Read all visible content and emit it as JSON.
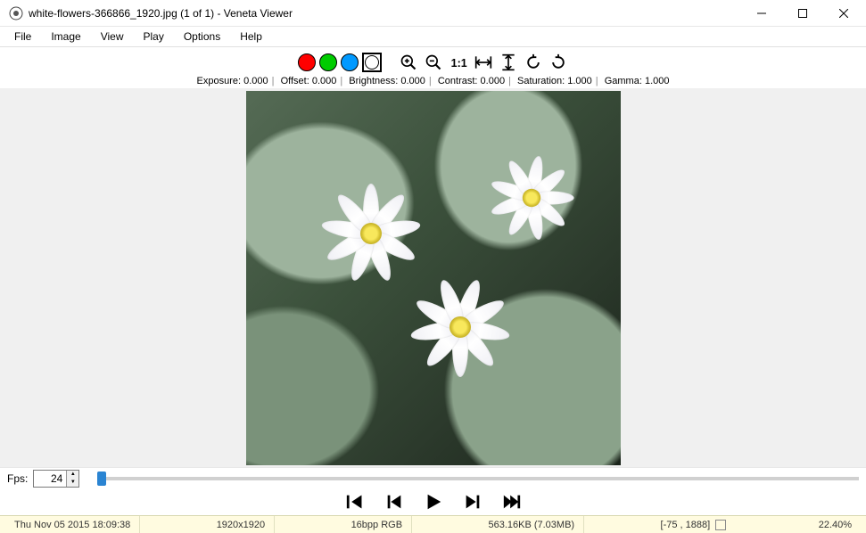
{
  "window": {
    "title": "white-flowers-366866_1920.jpg (1 of 1) - Veneta Viewer"
  },
  "menu": [
    "File",
    "Image",
    "View",
    "Play",
    "Options",
    "Help"
  ],
  "readout": {
    "exposure_label": "Exposure:",
    "exposure": "0.000",
    "offset_label": "Offset:",
    "offset": "0.000",
    "brightness_label": "Brightness:",
    "brightness": "0.000",
    "contrast_label": "Contrast:",
    "contrast": "0.000",
    "saturation_label": "Saturation:",
    "saturation": "1.000",
    "gamma_label": "Gamma:",
    "gamma": "1.000"
  },
  "fps": {
    "label": "Fps:",
    "value": "24"
  },
  "status": {
    "timestamp": "Thu Nov 05 2015 18:09:38",
    "dimensions": "1920x1920",
    "format": "16bpp RGB",
    "filesize": "563.16KB (7.03MB)",
    "coords": "[-75 , 1888]",
    "zoom": "22.40%"
  }
}
